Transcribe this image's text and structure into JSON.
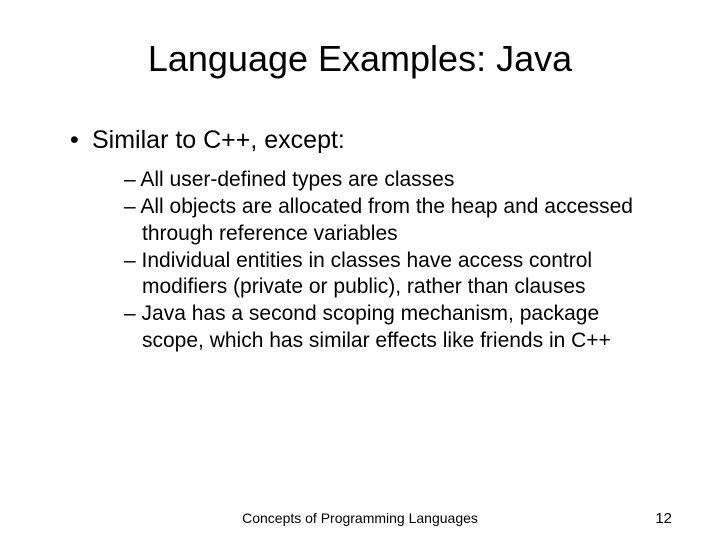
{
  "title": "Language Examples: Java",
  "main_bullet": "Similar to C++, except:",
  "sub_items": [
    "All user-defined types are classes",
    "All objects are allocated from the heap and accessed through reference variables",
    "Individual entities in classes have access control modifiers (private or public), rather than clauses",
    "Java has a second scoping mechanism, package scope, which has similar effects like friends in C++"
  ],
  "footer": {
    "text": "Concepts of Programming Languages",
    "page": "12"
  }
}
